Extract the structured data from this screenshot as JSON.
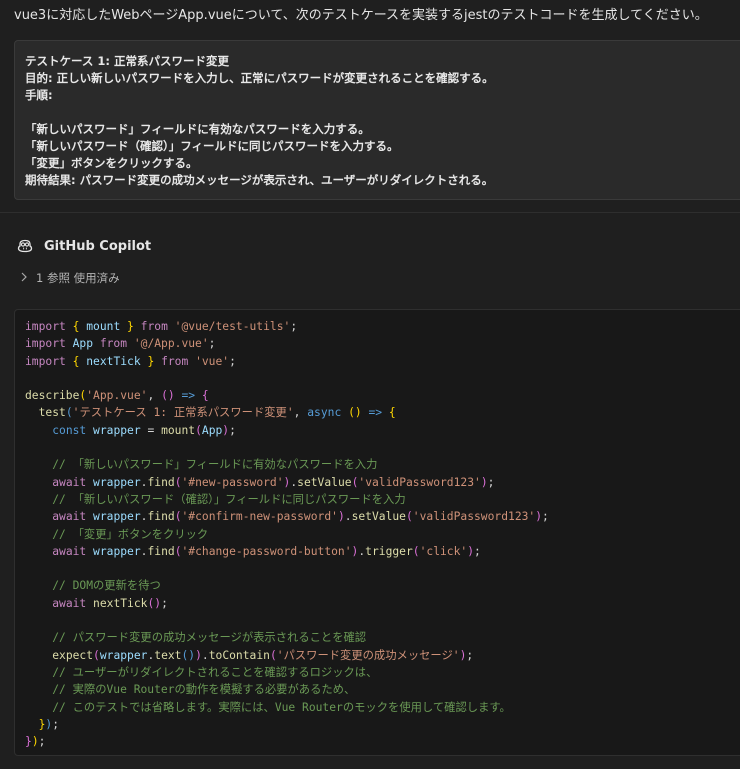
{
  "request": {
    "text": "vue3に対応したWebページApp.vueについて、次のテストケースを実装するjestのテストコードを生成してください。"
  },
  "prompt": {
    "lines": [
      "テストケース 1: 正常系パスワード変更",
      "目的: 正しい新しいパスワードを入力し、正常にパスワードが変更されることを確認する。",
      "手順:",
      "",
      "「新しいパスワード」フィールドに有効なパスワードを入力する。",
      "「新しいパスワード（確認）」フィールドに同じパスワードを入力する。",
      "「変更」ボタンをクリックする。",
      "期待結果: パスワード変更の成功メッセージが表示され、ユーザーがリダイレクトされる。"
    ]
  },
  "copilot": {
    "name": "GitHub Copilot",
    "references_label": "1 参照 使用済み"
  },
  "code": {
    "lines": [
      [
        [
          "kw",
          "import"
        ],
        [
          "pu",
          " "
        ],
        [
          "br",
          "{"
        ],
        [
          "vr",
          " mount "
        ],
        [
          "br",
          "}"
        ],
        [
          "kw",
          " from"
        ],
        [
          "st",
          " '@vue/test-utils'"
        ],
        [
          "pu",
          ";"
        ]
      ],
      [
        [
          "kw",
          "import"
        ],
        [
          "vr",
          " App"
        ],
        [
          "kw",
          " from"
        ],
        [
          "st",
          " '@/App.vue'"
        ],
        [
          "pu",
          ";"
        ]
      ],
      [
        [
          "kw",
          "import"
        ],
        [
          "pu",
          " "
        ],
        [
          "br",
          "{"
        ],
        [
          "vr",
          " nextTick "
        ],
        [
          "br",
          "}"
        ],
        [
          "kw",
          " from"
        ],
        [
          "st",
          " 'vue'"
        ],
        [
          "pu",
          ";"
        ]
      ],
      [],
      [
        [
          "fn",
          "describe"
        ],
        [
          "br",
          "("
        ],
        [
          "st",
          "'App.vue'"
        ],
        [
          "pu",
          ", "
        ],
        [
          "bm",
          "()"
        ],
        [
          "bl",
          " =>"
        ],
        [
          "pu",
          " "
        ],
        [
          "bm",
          "{"
        ]
      ],
      [
        [
          "pu",
          "  "
        ],
        [
          "fn",
          "test"
        ],
        [
          "bl",
          "("
        ],
        [
          "st",
          "'テストケース 1: 正常系パスワード変更'"
        ],
        [
          "pu",
          ", "
        ],
        [
          "bl",
          "async"
        ],
        [
          "pu",
          " "
        ],
        [
          "br",
          "()"
        ],
        [
          "bl",
          " =>"
        ],
        [
          "pu",
          " "
        ],
        [
          "br",
          "{"
        ]
      ],
      [
        [
          "pu",
          "    "
        ],
        [
          "bl",
          "const"
        ],
        [
          "vr",
          " wrapper"
        ],
        [
          "pu",
          " = "
        ],
        [
          "fn",
          "mount"
        ],
        [
          "bm",
          "("
        ],
        [
          "vr",
          "App"
        ],
        [
          "bm",
          ")"
        ],
        [
          "pu",
          ";"
        ]
      ],
      [],
      [
        [
          "cm",
          "    // 「新しいパスワード」フィールドに有効なパスワードを入力"
        ]
      ],
      [
        [
          "pu",
          "    "
        ],
        [
          "kw",
          "await"
        ],
        [
          "vr",
          " wrapper"
        ],
        [
          "pu",
          "."
        ],
        [
          "fn",
          "find"
        ],
        [
          "bm",
          "("
        ],
        [
          "st",
          "'#new-password'"
        ],
        [
          "bm",
          ")"
        ],
        [
          "pu",
          "."
        ],
        [
          "fn",
          "setValue"
        ],
        [
          "bm",
          "("
        ],
        [
          "st",
          "'validPassword123'"
        ],
        [
          "bm",
          ")"
        ],
        [
          "pu",
          ";"
        ]
      ],
      [
        [
          "cm",
          "    // 「新しいパスワード（確認）」フィールドに同じパスワードを入力"
        ]
      ],
      [
        [
          "pu",
          "    "
        ],
        [
          "kw",
          "await"
        ],
        [
          "vr",
          " wrapper"
        ],
        [
          "pu",
          "."
        ],
        [
          "fn",
          "find"
        ],
        [
          "bm",
          "("
        ],
        [
          "st",
          "'#confirm-new-password'"
        ],
        [
          "bm",
          ")"
        ],
        [
          "pu",
          "."
        ],
        [
          "fn",
          "setValue"
        ],
        [
          "bm",
          "("
        ],
        [
          "st",
          "'validPassword123'"
        ],
        [
          "bm",
          ")"
        ],
        [
          "pu",
          ";"
        ]
      ],
      [
        [
          "cm",
          "    // 「変更」ボタンをクリック"
        ]
      ],
      [
        [
          "pu",
          "    "
        ],
        [
          "kw",
          "await"
        ],
        [
          "vr",
          " wrapper"
        ],
        [
          "pu",
          "."
        ],
        [
          "fn",
          "find"
        ],
        [
          "bm",
          "("
        ],
        [
          "st",
          "'#change-password-button'"
        ],
        [
          "bm",
          ")"
        ],
        [
          "pu",
          "."
        ],
        [
          "fn",
          "trigger"
        ],
        [
          "bm",
          "("
        ],
        [
          "st",
          "'click'"
        ],
        [
          "bm",
          ")"
        ],
        [
          "pu",
          ";"
        ]
      ],
      [],
      [
        [
          "cm",
          "    // DOMの更新を待つ"
        ]
      ],
      [
        [
          "pu",
          "    "
        ],
        [
          "kw",
          "await"
        ],
        [
          "pu",
          " "
        ],
        [
          "fn",
          "nextTick"
        ],
        [
          "bm",
          "()"
        ],
        [
          "pu",
          ";"
        ]
      ],
      [],
      [
        [
          "cm",
          "    // パスワード変更の成功メッセージが表示されることを確認"
        ]
      ],
      [
        [
          "pu",
          "    "
        ],
        [
          "fn",
          "expect"
        ],
        [
          "bm",
          "("
        ],
        [
          "vr",
          "wrapper"
        ],
        [
          "pu",
          "."
        ],
        [
          "fn",
          "text"
        ],
        [
          "bl",
          "()"
        ],
        [
          "bm",
          ")"
        ],
        [
          "pu",
          "."
        ],
        [
          "fn",
          "toContain"
        ],
        [
          "bm",
          "("
        ],
        [
          "st",
          "'パスワード変更の成功メッセージ'"
        ],
        [
          "bm",
          ")"
        ],
        [
          "pu",
          ";"
        ]
      ],
      [
        [
          "cm",
          "    // ユーザーがリダイレクトされることを確認するロジックは、"
        ]
      ],
      [
        [
          "cm",
          "    // 実際のVue Routerの動作を模擬する必要があるため、"
        ]
      ],
      [
        [
          "cm",
          "    // このテストでは省略します。実際には、Vue Routerのモックを使用して確認します。"
        ]
      ],
      [
        [
          "pu",
          "  "
        ],
        [
          "br",
          "}"
        ],
        [
          "bl",
          ")"
        ],
        [
          "pu",
          ";"
        ]
      ],
      [
        [
          "bm",
          "}"
        ],
        [
          "br",
          ")"
        ],
        [
          "pu",
          ";"
        ]
      ]
    ]
  },
  "colors": {
    "background": "#1f1f1f",
    "keyword": "#c586c0",
    "string": "#ce9178",
    "function": "#dcdcaa",
    "variable": "#9cdcfe",
    "comment": "#6a9955",
    "bracket_gold": "#ffd700",
    "bracket_magenta": "#da70d6",
    "builtin_blue": "#569cd6"
  },
  "icons": {
    "copilot": "copilot-icon",
    "chevron": "chevron-right-icon"
  }
}
